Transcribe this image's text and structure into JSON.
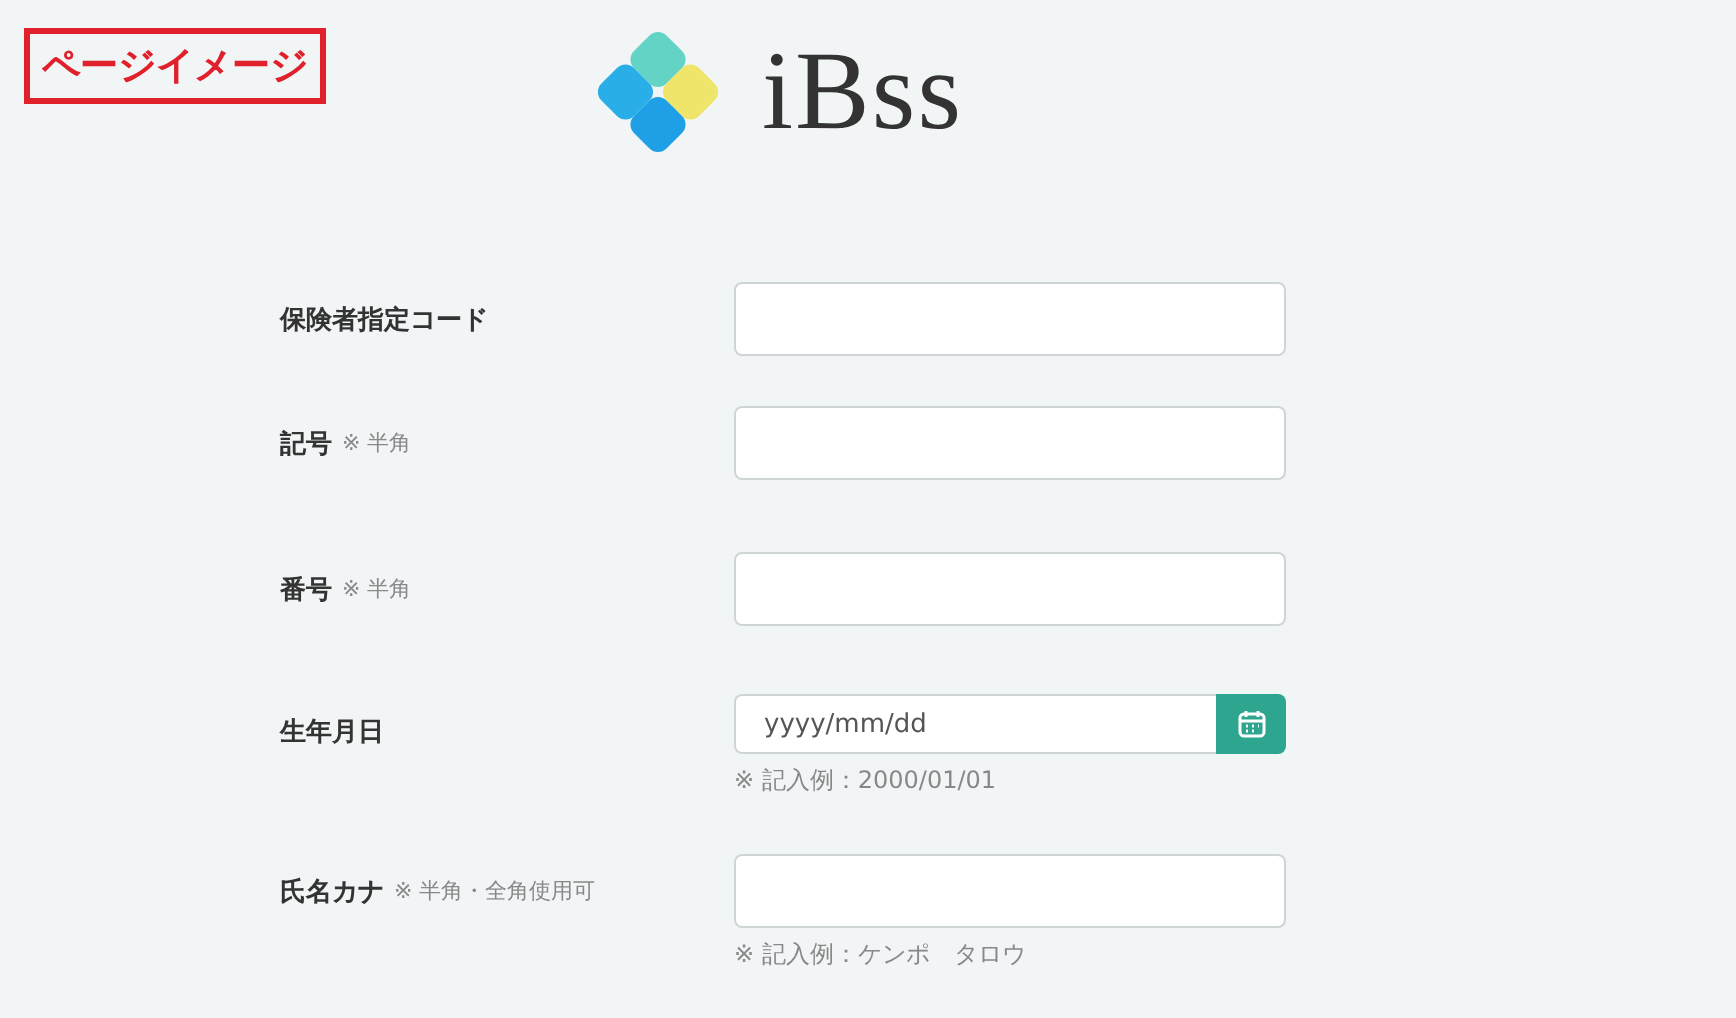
{
  "page_label": "ページイメージ",
  "logo": {
    "text": "iBss"
  },
  "fields": [
    {
      "kind": "text",
      "label": "保険者指定コード"
    },
    {
      "kind": "text",
      "label": "記号",
      "note": "※ 半角"
    },
    {
      "kind": "text",
      "label": "番号",
      "note": "※ 半角"
    },
    {
      "kind": "date",
      "label": "生年月日",
      "placeholder": "yyyy/mm/dd",
      "hint": "※ 記入例：2000/01/01"
    },
    {
      "kind": "text",
      "label": "氏名カナ",
      "note": "※ 半角・全角使用可",
      "hint": "※ 記入例：ケンポ　タロウ"
    }
  ]
}
